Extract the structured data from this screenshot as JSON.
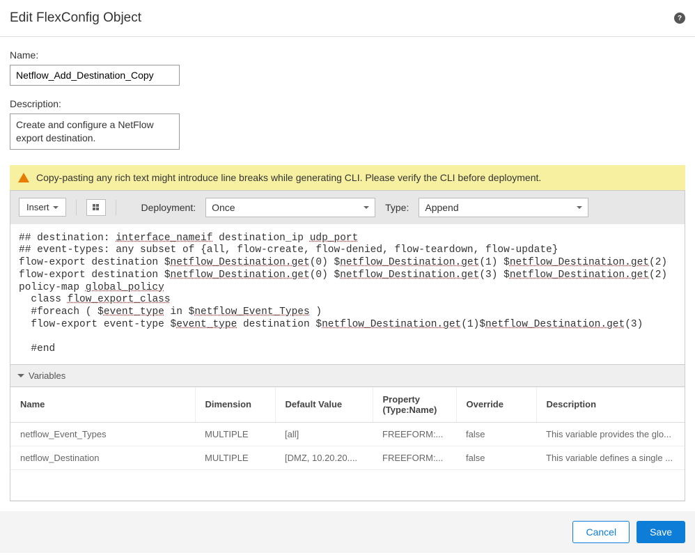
{
  "header": {
    "title": "Edit FlexConfig Object"
  },
  "form": {
    "name_label": "Name:",
    "name_value": "Netflow_Add_Destination_Copy",
    "desc_label": "Description:",
    "desc_value": "Create and configure a NetFlow export destination."
  },
  "warning": "Copy-pasting any rich text might introduce line breaks while generating CLI. Please verify the CLI before deployment.",
  "toolbar": {
    "insert_label": "Insert",
    "deployment_label": "Deployment:",
    "deployment_value": "Once",
    "type_label": "Type:",
    "type_value": "Append"
  },
  "code_lines": [
    {
      "pre": "## destination: ",
      "u": "interface_nameif",
      "post": " destination_ip ",
      "u2": "udp_port",
      "post2": ""
    },
    {
      "pre": "## event-types: any subset of {all, flow-create, flow-denied, flow-teardown, flow-update}"
    },
    {
      "pre": "flow-export destination $",
      "u": "netflow_Destination.get",
      "post": "(0) $",
      "u2": "netflow_Destination.get",
      "post2": "(1) $",
      "u3": "netflow_Destination.get",
      "post3": "(2)"
    },
    {
      "pre": "flow-export destination $",
      "u": "netflow_Destination.get",
      "post": "(0) $",
      "u2": "netflow_Destination.get",
      "post2": "(3) $",
      "u3": "netflow_Destination.get",
      "post3": "(2)"
    },
    {
      "pre": "policy-map ",
      "u": "global_policy",
      "post": ""
    },
    {
      "pre": "  class ",
      "u": "flow_export_class",
      "post": ""
    },
    {
      "pre": "  #foreach ( $",
      "u": "event_type",
      "post": " in $",
      "u2": "netflow_Event_Types",
      "post2": " )"
    },
    {
      "pre": "  flow-export event-type $",
      "u": "event_type",
      "post": " destination $",
      "u2": "netflow_Destination.get",
      "post2": "(1)$",
      "u3": "netflow_Destination.get",
      "post3": "(3)"
    },
    {
      "pre": ""
    },
    {
      "pre": "  #end"
    }
  ],
  "variables": {
    "section_label": "Variables",
    "columns": {
      "name": "Name",
      "dimension": "Dimension",
      "default": "Default Value",
      "property": "Property (Type:Name)",
      "override": "Override",
      "description": "Description"
    },
    "rows": [
      {
        "name": "netflow_Event_Types",
        "dimension": "MULTIPLE",
        "default": "[all]",
        "property": "FREEFORM:...",
        "override": "false",
        "description": "This variable provides the glo..."
      },
      {
        "name": "netflow_Destination",
        "dimension": "MULTIPLE",
        "default": "[DMZ, 10.20.20....",
        "property": "FREEFORM:...",
        "override": "false",
        "description": "This variable defines a single ..."
      }
    ]
  },
  "footer": {
    "cancel": "Cancel",
    "save": "Save"
  }
}
